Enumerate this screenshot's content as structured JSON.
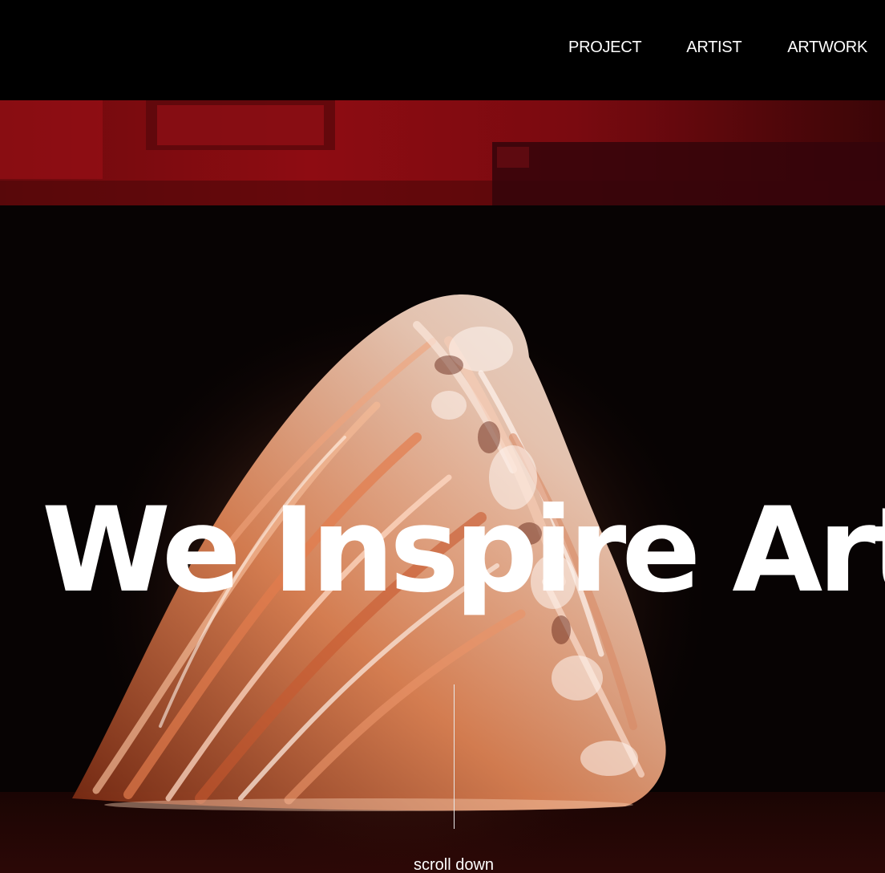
{
  "nav": {
    "items": [
      {
        "label": "PROJECT"
      },
      {
        "label": "ARTIST"
      },
      {
        "label": "ARTWORK"
      }
    ]
  },
  "hero": {
    "title": "We Inspire Art",
    "scroll_label": "scroll down"
  },
  "colors": {
    "header_bg": "#000000",
    "text": "#ffffff",
    "wall_red": "#7a0a0e",
    "sculpture_orange": "#e58a5c"
  }
}
